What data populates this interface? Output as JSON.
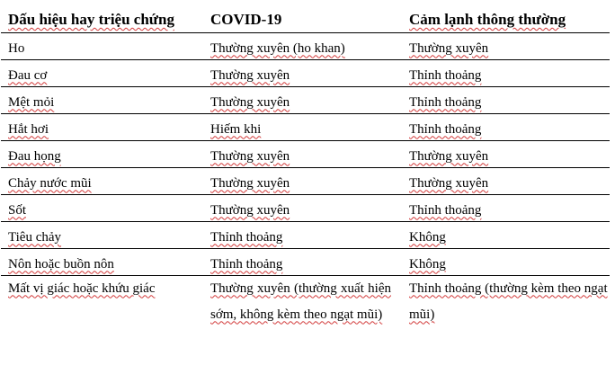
{
  "table": {
    "headers": [
      "Dấu hiệu hay triệu chứng",
      "COVID-19",
      "Cảm lạnh thông thường"
    ],
    "rows": [
      [
        "Ho",
        "Thường xuyên (ho khan)",
        "Thường xuyên"
      ],
      [
        "Đau cơ",
        "Thường xuyên",
        "Thỉnh thoảng"
      ],
      [
        "Mệt mỏi",
        "Thường xuyên",
        "Thỉnh thoảng"
      ],
      [
        "Hắt hơi",
        "Hiếm khi",
        "Thỉnh thoảng"
      ],
      [
        "Đau họng",
        "Thường xuyên",
        "Thường xuyên"
      ],
      [
        "Chảy nước mũi",
        "Thường xuyên",
        "Thường xuyên"
      ],
      [
        "Sốt",
        "Thường xuyên",
        "Thỉnh thoảng"
      ],
      [
        "Tiêu chảy",
        "Thỉnh thoảng",
        "Không"
      ],
      [
        "Nôn hoặc buồn nôn",
        "Thỉnh thoảng",
        "Không"
      ],
      [
        "Mất vị giác hoặc khứu giác",
        "Thường xuyên (thường xuất hiện sớm, không kèm theo ngạt mũi)",
        "Thỉnh thoảng (thường kèm theo ngạt mũi)"
      ]
    ]
  },
  "colors": {
    "text": "#000000",
    "rule": "#000000",
    "spellcheck_underline": "#d23a3a"
  }
}
